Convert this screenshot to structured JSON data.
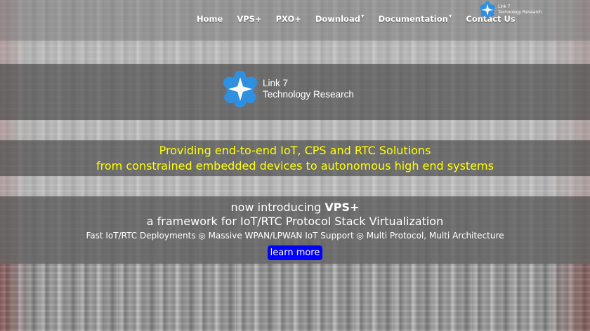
{
  "nav": {
    "items": [
      {
        "label": "Home"
      },
      {
        "label": "VPS+"
      },
      {
        "label": "PXO+"
      },
      {
        "label": "Download",
        "dropdown": true
      },
      {
        "label": "Documentation",
        "dropdown": true
      },
      {
        "label": "Contact Us"
      }
    ]
  },
  "brand": {
    "line1": "Link 7",
    "line2": "Technology Research",
    "icon": "blue-star-cloud-icon",
    "icon_color": "#2f8fe0"
  },
  "hero": {
    "tagline_line1": "Providing end-to-end IoT, CPS and RTC Solutions",
    "tagline_line2": "from constrained embedded devices to autonomous high end systems",
    "tagline_color": "#ffff00"
  },
  "intro": {
    "prefix": "now introducing ",
    "product": "VPS+",
    "subtitle": "a framework for IoT/RTC Protocol Stack Virtualization",
    "features": "Fast IoT/RTC Deployments ◎ Massive WPAN/LPWAN IoT Support ◎ Multi Protocol, Multi Architecture",
    "cta": "learn more",
    "cta_color": "#0000ff"
  }
}
